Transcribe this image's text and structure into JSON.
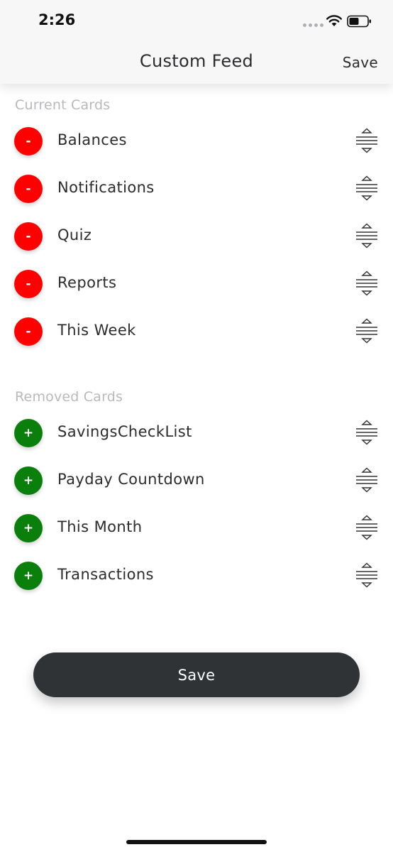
{
  "status_bar": {
    "time": "2:26"
  },
  "header": {
    "title": "Custom Feed",
    "save_label": "Save"
  },
  "current_cards": {
    "label": "Current Cards",
    "items": [
      {
        "label": "Balances",
        "action": "-"
      },
      {
        "label": "Notifications",
        "action": "-"
      },
      {
        "label": "Quiz",
        "action": "-"
      },
      {
        "label": "Reports",
        "action": "-"
      },
      {
        "label": "This Week",
        "action": "-"
      }
    ]
  },
  "removed_cards": {
    "label": "Removed Cards",
    "items": [
      {
        "label": "SavingsCheckList",
        "action": "+"
      },
      {
        "label": "Payday Countdown",
        "action": "+"
      },
      {
        "label": "This Month",
        "action": "+"
      },
      {
        "label": "Transactions",
        "action": "+"
      }
    ]
  },
  "footer": {
    "save_label": "Save"
  },
  "colors": {
    "remove": "#ff0000",
    "add": "#0b7f0b",
    "button_dark": "#2f3336",
    "section_label": "#b9b9bd"
  },
  "icons": {
    "remove": "minus-icon",
    "add": "plus-icon",
    "drag": "drag-handle-icon"
  }
}
